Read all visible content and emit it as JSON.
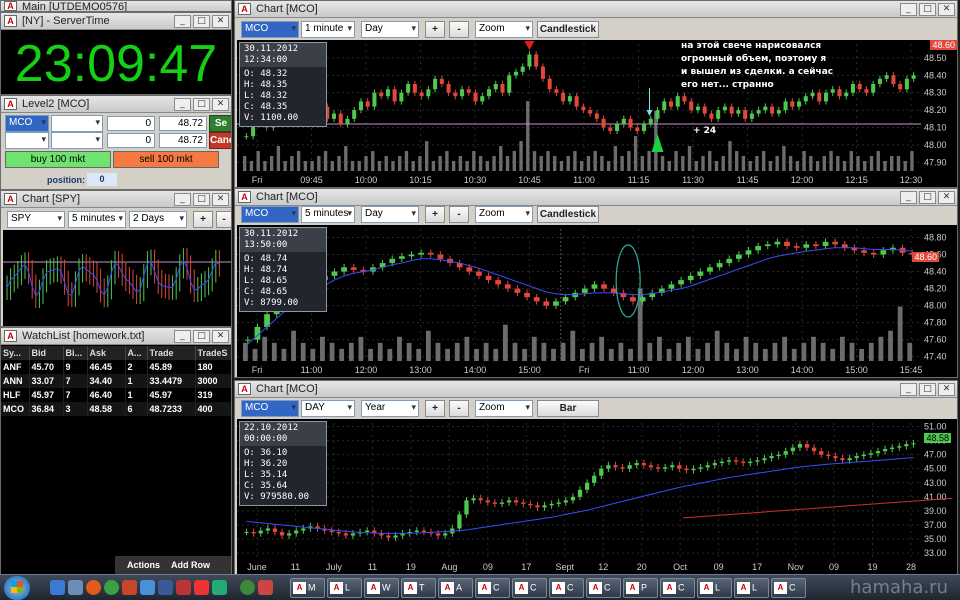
{
  "main": {
    "title": "Main [UTDEMO0576]"
  },
  "servertime": {
    "title": "[NY] - ServerTime",
    "time": "23:09:47"
  },
  "level2": {
    "title": "Level2 [MCO]",
    "symbol": "MCO",
    "rows": [
      {
        "qty": "0",
        "price": "48.72",
        "action": "Se"
      },
      {
        "qty": "0",
        "price": "48.72",
        "action": "Canc"
      }
    ],
    "buy_label": "buy 100 mkt",
    "sell_label": "sell 100 mkt",
    "position_label": "position:",
    "position_value": "0"
  },
  "small_chart": {
    "title": "Chart [SPY]",
    "symbol": "SPY",
    "interval": "5 minutes",
    "range": "2 Days"
  },
  "watchlist": {
    "title": "WatchList [homework.txt]",
    "columns": [
      "Sy...",
      "Bid",
      "Bi...",
      "Ask",
      "A...",
      "Trade",
      "TradeS"
    ],
    "rows": [
      [
        "ANF",
        "45.70",
        "9",
        "46.45",
        "2",
        "45.89",
        "180"
      ],
      [
        "ANN",
        "33.07",
        "7",
        "34.40",
        "1",
        "33.4479",
        "3000"
      ],
      [
        "HLF",
        "45.97",
        "7",
        "46.40",
        "1",
        "45.97",
        "319"
      ],
      [
        "MCO",
        "36.84",
        "3",
        "48.58",
        "6",
        "48.7233",
        "400"
      ]
    ],
    "actions_label": "Actions",
    "addrow_label": "Add Row"
  },
  "chart1": {
    "title": "Chart [MCO]",
    "symbol": "MCO",
    "interval": "1 minute",
    "range": "Day",
    "zoom": "Zoom",
    "style": "Candlestick",
    "info": {
      "time": "30.11.2012 12:34:00",
      "o": "O: 48.32",
      "h": "H: 48.35",
      "l": "L: 48.32",
      "c": "C: 48.35",
      "v": "V: 1100.00"
    },
    "note": "на этой свече нарисовался\nогромный объем, поэтому я\nи вышел из сделки. а сейчас\nего нет... странно",
    "marker": "+ 24",
    "price_tag": "48.60",
    "chart_data": {
      "type": "candlestick",
      "y_ticks": [
        "48.50",
        "48.40",
        "48.30",
        "48.20",
        "48.10",
        "48.00",
        "47.90"
      ],
      "x_ticks": [
        "Fri",
        "09:45",
        "10:00",
        "10:15",
        "10:30",
        "10:45",
        "11:00",
        "11:15",
        "11:30",
        "11:45",
        "12:00",
        "12:15",
        "12:30"
      ],
      "ylim": [
        47.85,
        48.58
      ],
      "hline": 48.12,
      "closes": [
        48.05,
        48.12,
        48.15,
        48.1,
        48.18,
        48.2,
        48.15,
        48.22,
        48.25,
        48.18,
        48.2,
        48.22,
        48.15,
        48.18,
        48.12,
        48.15,
        48.2,
        48.25,
        48.22,
        48.3,
        48.28,
        48.32,
        48.25,
        48.3,
        48.35,
        48.3,
        48.28,
        48.32,
        48.38,
        48.35,
        48.3,
        48.28,
        48.32,
        48.3,
        48.25,
        48.28,
        48.32,
        48.35,
        48.3,
        48.4,
        48.42,
        48.45,
        48.52,
        48.45,
        48.38,
        48.32,
        48.3,
        48.25,
        48.28,
        48.22,
        48.2,
        48.18,
        48.15,
        48.1,
        48.08,
        48.12,
        48.15,
        48.1,
        48.08,
        48.12,
        48.15,
        48.2,
        48.25,
        48.22,
        48.28,
        48.25,
        48.2,
        48.22,
        48.18,
        48.15,
        48.2,
        48.22,
        48.18,
        48.2,
        48.15,
        48.18,
        48.2,
        48.22,
        48.18,
        48.2,
        48.25,
        48.22,
        48.25,
        48.28,
        48.3,
        48.25,
        48.3,
        48.32,
        48.28,
        48.3,
        48.35,
        48.32,
        48.3,
        48.35,
        48.38,
        48.4,
        48.35,
        48.32,
        48.38,
        48.4
      ],
      "volumes": [
        3,
        2,
        4,
        2,
        3,
        5,
        2,
        3,
        4,
        2,
        2,
        3,
        4,
        2,
        3,
        5,
        2,
        2,
        3,
        4,
        2,
        3,
        2,
        3,
        4,
        2,
        3,
        6,
        2,
        3,
        4,
        2,
        3,
        2,
        4,
        3,
        2,
        3,
        5,
        3,
        4,
        6,
        14,
        4,
        3,
        4,
        3,
        2,
        3,
        4,
        2,
        3,
        4,
        3,
        2,
        5,
        3,
        4,
        7,
        3,
        4,
        12,
        3,
        2,
        4,
        3,
        5,
        2,
        3,
        4,
        2,
        3,
        6,
        4,
        3,
        2,
        3,
        4,
        2,
        3,
        5,
        3,
        2,
        4,
        3,
        2,
        3,
        4,
        3,
        2,
        4,
        3,
        2,
        3,
        4,
        2,
        3,
        3,
        2,
        4
      ]
    }
  },
  "chart2": {
    "title": "Chart [MCO]",
    "symbol": "MCO",
    "interval": "5 minutes",
    "range": "Day",
    "zoom": "Zoom",
    "style": "Candlestick",
    "info": {
      "time": "30.11.2012 13:50:00",
      "o": "O: 48.74",
      "h": "H: 48.74",
      "l": "L: 48.65",
      "c": "C: 48.65",
      "v": "V: 8799.00"
    },
    "price_tag": "48.60",
    "chart_data": {
      "type": "candlestick",
      "y_ticks": [
        "48.80",
        "48.60",
        "48.40",
        "48.20",
        "48.00",
        "47.80",
        "47.60",
        "47.40"
      ],
      "x_ticks": [
        "Fri",
        "11:00",
        "12:00",
        "13:00",
        "14:00",
        "15:00",
        "Fri",
        "11:00",
        "12:00",
        "13:00",
        "14:00",
        "15:00",
        "15:45"
      ],
      "ylim": [
        47.35,
        48.9
      ],
      "closes": [
        47.6,
        47.75,
        47.9,
        48.0,
        48.1,
        48.2,
        48.25,
        48.3,
        48.35,
        48.4,
        48.45,
        48.42,
        48.4,
        48.45,
        48.5,
        48.55,
        48.58,
        48.6,
        48.62,
        48.6,
        48.55,
        48.5,
        48.45,
        48.4,
        48.35,
        48.3,
        48.25,
        48.2,
        48.15,
        48.1,
        48.05,
        48.0,
        48.05,
        48.1,
        48.15,
        48.2,
        48.25,
        48.2,
        48.15,
        48.1,
        48.05,
        48.1,
        48.15,
        48.2,
        48.25,
        48.3,
        48.35,
        48.4,
        48.45,
        48.5,
        48.55,
        48.6,
        48.65,
        48.7,
        48.72,
        48.75,
        48.7,
        48.68,
        48.72,
        48.7,
        48.75,
        48.72,
        48.68,
        48.65,
        48.62,
        48.6,
        48.65,
        48.68,
        48.62,
        48.6
      ],
      "ma": [
        47.55,
        47.65,
        47.75,
        47.85,
        47.95,
        48.05,
        48.12,
        48.18,
        48.24,
        48.3,
        48.35,
        48.38,
        48.4,
        48.42,
        48.45,
        48.48,
        48.5,
        48.53,
        48.55,
        48.55,
        48.54,
        48.52,
        48.5,
        48.47,
        48.44,
        48.4,
        48.36,
        48.32,
        48.28,
        48.24,
        48.2,
        48.16,
        48.14,
        48.13,
        48.13,
        48.14,
        48.15,
        48.15,
        48.15,
        48.14,
        48.13,
        48.13,
        48.14,
        48.16,
        48.18,
        48.2,
        48.23,
        48.27,
        48.31,
        48.35,
        48.39,
        48.43,
        48.47,
        48.51,
        48.55,
        48.58,
        48.6,
        48.62,
        48.64,
        48.65,
        48.67,
        48.68,
        48.68,
        48.68,
        48.67,
        48.66,
        48.66,
        48.66,
        48.65,
        48.64
      ],
      "volumes": [
        3,
        2,
        4,
        3,
        2,
        5,
        3,
        2,
        4,
        3,
        2,
        3,
        4,
        2,
        3,
        2,
        4,
        3,
        2,
        5,
        3,
        2,
        3,
        4,
        2,
        3,
        2,
        6,
        3,
        2,
        4,
        3,
        2,
        3,
        5,
        2,
        3,
        4,
        2,
        3,
        2,
        12,
        3,
        4,
        2,
        3,
        4,
        2,
        3,
        5,
        3,
        2,
        4,
        3,
        2,
        3,
        4,
        2,
        3,
        4,
        3,
        2,
        4,
        3,
        2,
        3,
        4,
        5,
        9,
        3
      ]
    }
  },
  "chart3": {
    "title": "Chart [MCO]",
    "symbol": "MCO",
    "interval": "DAY",
    "range": "Year",
    "zoom": "Zoom",
    "style": "Bar",
    "info": {
      "time": "22.10.2012 00:00:00",
      "o": "O: 36.10",
      "h": "H: 36.20",
      "l": "L: 35.14",
      "c": "C: 35.64",
      "v": "V: 979580.00"
    },
    "price_tag": "48.58",
    "chart_data": {
      "type": "candlestick",
      "y_ticks": [
        "51.00",
        "49.00",
        "47.00",
        "45.00",
        "43.00",
        "41.00",
        "39.00",
        "37.00",
        "35.00",
        "33.00"
      ],
      "x_ticks": [
        "June",
        "11",
        "July",
        "11",
        "19",
        "Aug",
        "09",
        "17",
        "Sept",
        "12",
        "20",
        "Oct",
        "09",
        "17",
        "Nov",
        "09",
        "19",
        "28"
      ],
      "ylim": [
        32.3,
        51.5
      ],
      "closes": [
        36.0,
        35.8,
        36.2,
        36.5,
        36.0,
        35.5,
        35.8,
        36.2,
        36.5,
        36.8,
        36.5,
        36.2,
        36.0,
        35.8,
        35.5,
        35.8,
        36.0,
        36.2,
        35.8,
        35.5,
        35.2,
        35.5,
        35.8,
        36.0,
        36.2,
        36.0,
        35.8,
        35.5,
        35.8,
        36.5,
        38.5,
        40.5,
        40.8,
        40.5,
        40.2,
        40.0,
        40.2,
        40.5,
        40.2,
        40.0,
        39.8,
        39.5,
        39.8,
        40.0,
        40.2,
        40.5,
        41.0,
        42.0,
        43.0,
        44.0,
        45.0,
        45.5,
        45.2,
        45.0,
        45.5,
        45.8,
        45.5,
        45.2,
        45.0,
        45.2,
        45.5,
        45.0,
        44.8,
        45.0,
        45.2,
        45.5,
        45.8,
        46.0,
        46.2,
        46.0,
        45.8,
        46.0,
        46.2,
        46.5,
        46.8,
        47.0,
        47.5,
        48.0,
        48.5,
        48.0,
        47.5,
        47.0,
        46.8,
        46.5,
        46.2,
        46.5,
        46.8,
        47.0,
        47.2,
        47.5,
        47.8,
        48.0,
        48.2,
        48.5,
        48.6
      ],
      "ma": [
        37.5,
        37.4,
        37.3,
        37.2,
        37.1,
        37.0,
        36.9,
        36.8,
        36.7,
        36.6,
        36.5,
        36.4,
        36.3,
        36.2,
        36.1,
        36.0,
        35.95,
        35.9,
        35.85,
        35.8,
        35.8,
        35.8,
        35.8,
        35.82,
        35.85,
        35.9,
        35.95,
        36.0,
        36.05,
        36.1,
        36.2,
        36.3,
        36.45,
        36.6,
        36.75,
        36.9,
        37.05,
        37.2,
        37.35,
        37.5,
        37.65,
        37.8,
        37.95,
        38.1,
        38.3,
        38.5,
        38.7,
        38.9,
        39.1,
        39.35,
        39.6,
        39.85,
        40.1,
        40.35,
        40.6,
        40.85,
        41.1,
        41.35,
        41.6,
        41.85,
        42.1,
        42.35,
        42.55,
        42.75,
        42.95,
        43.15,
        43.35,
        43.55,
        43.75,
        43.9,
        44.05,
        44.2,
        44.35,
        44.5,
        44.65,
        44.8,
        44.95,
        45.1,
        45.25,
        45.35,
        45.45,
        45.55,
        45.65,
        45.72,
        45.8,
        45.88,
        45.95,
        46.02,
        46.1,
        46.18,
        46.26,
        46.34,
        46.42,
        46.5,
        46.58
      ],
      "trendline": [
        [
          62,
          38.0
        ],
        [
          100,
          40.8
        ]
      ]
    }
  },
  "taskbar": {
    "buttons": [
      "M",
      "L",
      "W",
      "T",
      "A",
      "C",
      "C",
      "C",
      "C",
      "P",
      "C",
      "L",
      "L",
      "C"
    ],
    "watermark": "hamaha.ru"
  },
  "colors": {
    "up": "#4fc84f",
    "down": "#e0483a",
    "ma": "#3a4cff",
    "grid": "#2a2a2a",
    "text": "#ffffff",
    "clock": "#16d016"
  }
}
